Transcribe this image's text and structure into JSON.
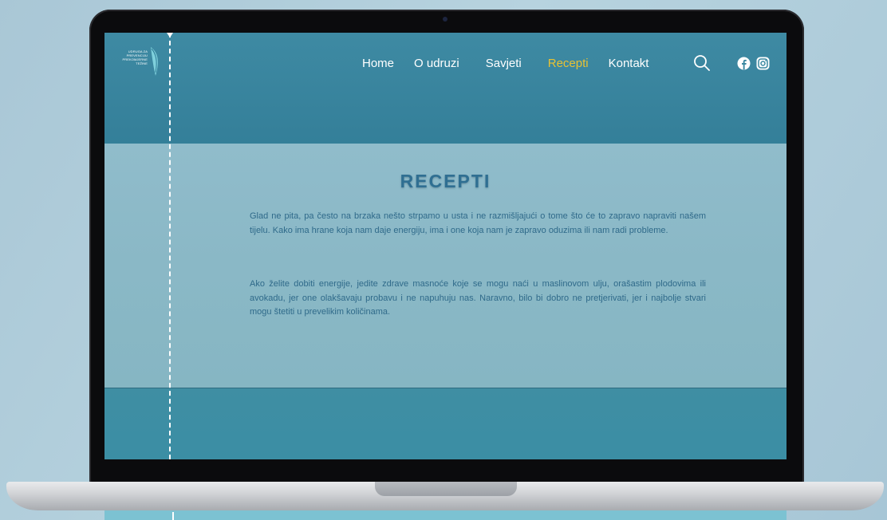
{
  "site": {
    "logo_text": "UDRUGA ZA PREVENCIJU PREKOMJERNE TEŽINE",
    "nav": [
      {
        "label": "Home",
        "active": false
      },
      {
        "label": "O udruzi",
        "active": false
      },
      {
        "label": "Savjeti",
        "active": false
      },
      {
        "label": "Recepti",
        "active": true
      },
      {
        "label": "Kontakt",
        "active": false
      }
    ],
    "icons": {
      "search": "search-icon",
      "facebook": "facebook-icon",
      "instagram": "instagram-icon"
    },
    "colors": {
      "accent_active": "#e8c233",
      "heading": "#2f6f92",
      "body_text": "#2f6a8a",
      "header_bg": "#3a88a1",
      "content_bg": "#8ab8c6"
    }
  },
  "page": {
    "title": "RECEPTI",
    "paragraphs": [
      "Glad ne pita, pa često na brzaka nešto strpamo u usta i ne razmišljajući o tome što će to zapravo napraviti našem tijelu. Kako ima hrane koja nam daje energiju, ima i one koja nam je zapravo oduzima ili nam radi probleme.",
      "Ako želite dobiti energije, jedite zdrave masnoće koje se mogu naći u maslinovom ulju, orašastim plodovima ili avokadu, jer one olakšavaju probavu i ne napuhuju nas. Naravno, bilo bi dobro ne pretjerivati, jer i najbolje stvari mogu štetiti u prevelikim količinama."
    ]
  }
}
